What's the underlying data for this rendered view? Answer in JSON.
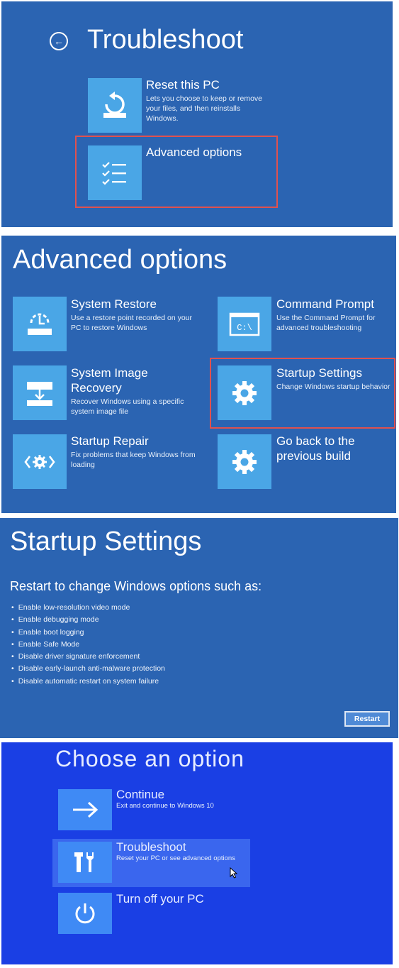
{
  "troubleshoot": {
    "title": "Troubleshoot",
    "reset": {
      "title": "Reset this PC",
      "desc": "Lets you choose to keep or remove your files, and then reinstalls Windows."
    },
    "advanced": {
      "title": "Advanced options"
    }
  },
  "advanced_options": {
    "title": "Advanced options",
    "system_restore": {
      "title": "System Restore",
      "desc": "Use a restore point recorded on your PC to restore Windows"
    },
    "command_prompt": {
      "title": "Command Prompt",
      "desc": "Use the Command Prompt for advanced troubleshooting",
      "icon_text": "C:\\"
    },
    "system_image": {
      "title": "System Image Recovery",
      "desc": "Recover Windows using a specific system image file"
    },
    "startup_settings": {
      "title": "Startup Settings",
      "desc": "Change Windows startup behavior"
    },
    "startup_repair": {
      "title": "Startup Repair",
      "desc": "Fix problems that keep Windows from loading"
    },
    "go_back": {
      "title": "Go back to the previous build"
    }
  },
  "startup_settings": {
    "title": "Startup Settings",
    "subtitle": "Restart to change Windows options such as:",
    "options": [
      "Enable low-resolution video mode",
      "Enable debugging mode",
      "Enable boot logging",
      "Enable Safe Mode",
      "Disable driver signature enforcement",
      "Disable early-launch anti-malware protection",
      "Disable automatic restart on system failure"
    ],
    "restart_label": "Restart"
  },
  "choose_option": {
    "title": "Choose an option",
    "continue": {
      "title": "Continue",
      "desc": "Exit and continue to Windows 10"
    },
    "troubleshoot": {
      "title": "Troubleshoot",
      "desc": "Reset your PC or see advanced options"
    },
    "turn_off": {
      "title": "Turn off your PC"
    }
  },
  "colors": {
    "panel_blue": "#2b64b2",
    "tile_blue": "#4aa6e6",
    "choose_bg": "#1a3fe4",
    "highlight_red": "#e0514f"
  }
}
